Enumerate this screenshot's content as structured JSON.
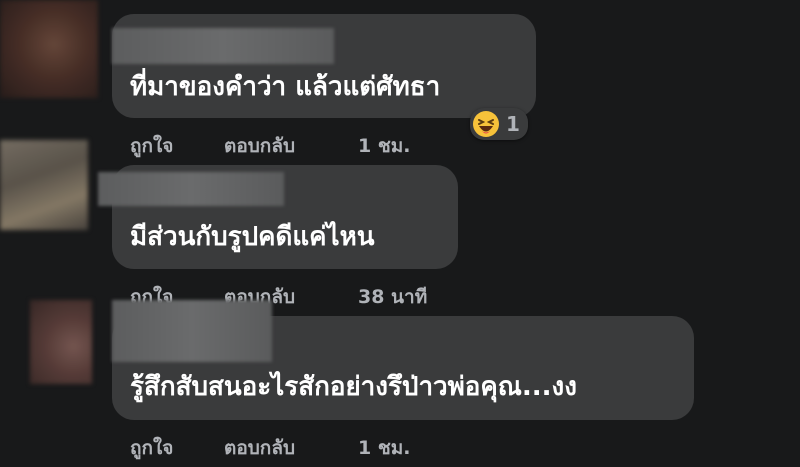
{
  "comments": [
    {
      "text": "ที่มาของคำว่า แล้วแต่ศัทธา",
      "like_label": "ถูกใจ",
      "reply_label": "ตอบกลับ",
      "time": "1 ชม.",
      "reaction_icon": "haha-emoji-icon",
      "reaction_count": "1"
    },
    {
      "text": "มีส่วนกับรูปคดีแค่ไหน",
      "like_label": "ถูกใจ",
      "reply_label": "ตอบกลับ",
      "time": "38 นาที"
    },
    {
      "text": "รู้สึกสับสนอะไรสักอย่างรึป่าวพ่อคุณ...งง",
      "like_label": "ถูกใจ",
      "reply_label": "ตอบกลับ",
      "time": "1 ชม."
    }
  ],
  "colors": {
    "background": "#18191a",
    "bubble": "#3a3b3c",
    "text": "#ffffff",
    "secondary_text": "#b0b3b8"
  }
}
